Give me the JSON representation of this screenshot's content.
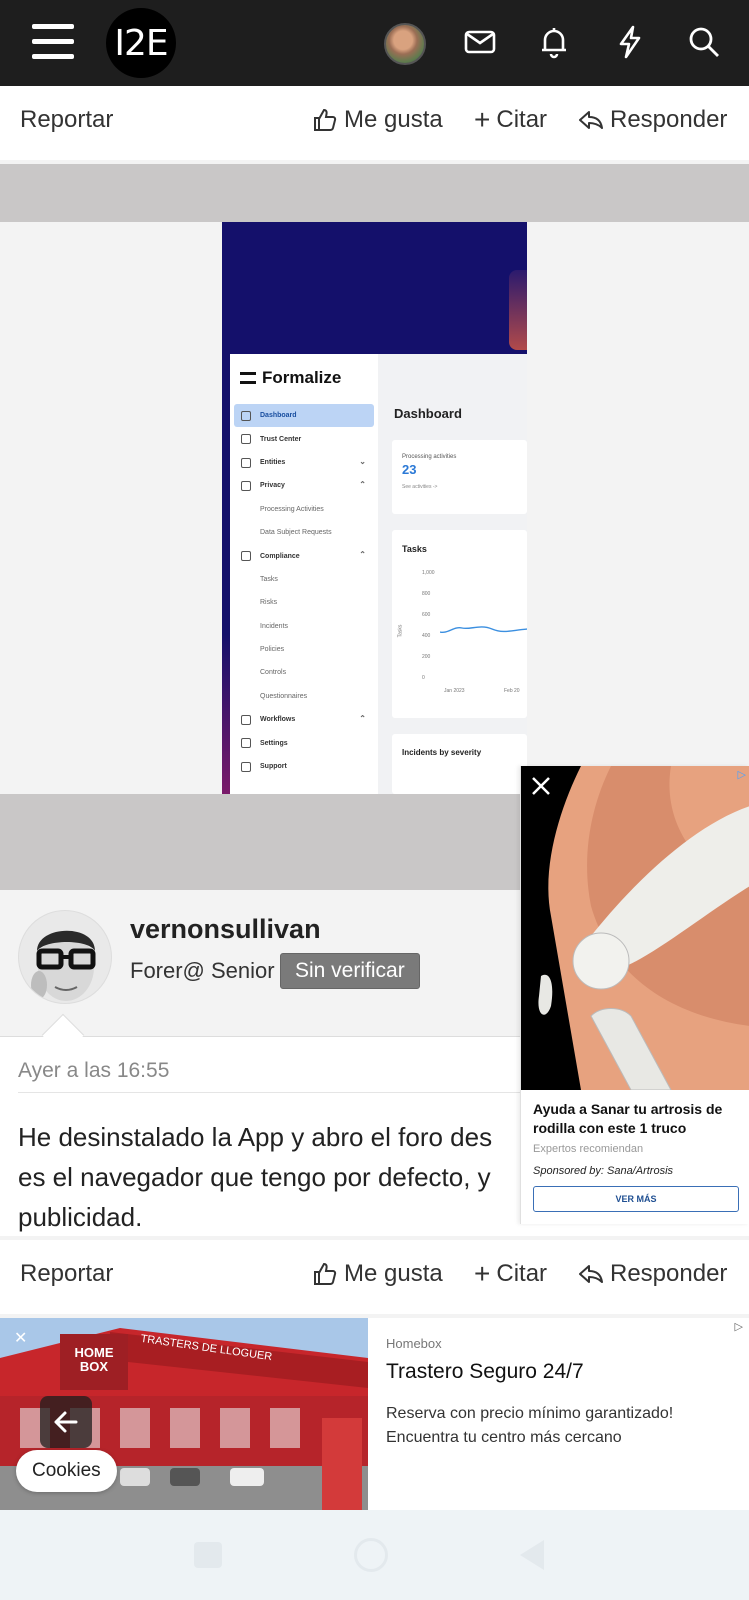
{
  "header": {
    "logo_text": "I2E",
    "icons": [
      "menu-icon",
      "avatar",
      "mail-icon",
      "bell-icon",
      "bolt-icon",
      "search-icon"
    ]
  },
  "actions": {
    "report": "Reportar",
    "like": "Me gusta",
    "quote": "Citar",
    "reply": "Responder"
  },
  "screenshot": {
    "app_name": "Formalize",
    "nav": [
      {
        "label": "Dashboard",
        "active": true
      },
      {
        "label": "Trust Center"
      },
      {
        "label": "Entities"
      },
      {
        "label": "Privacy"
      },
      {
        "label": "Processing Activities"
      },
      {
        "label": "Data Subject Requests"
      },
      {
        "label": "Compliance"
      },
      {
        "label": "Tasks"
      },
      {
        "label": "Risks"
      },
      {
        "label": "Incidents"
      },
      {
        "label": "Policies"
      },
      {
        "label": "Controls"
      },
      {
        "label": "Questionnaires"
      },
      {
        "label": "Workflows"
      },
      {
        "label": "Settings"
      },
      {
        "label": "Support"
      }
    ],
    "dashboard_title": "Dashboard",
    "processing_label": "Processing activities",
    "processing_value": "23",
    "processing_link": "See activities ->",
    "tasks_title": "Tasks",
    "tasks_axis": [
      "1,000",
      "800",
      "600",
      "400",
      "200",
      "0"
    ],
    "tasks_x": [
      "Jan 2023",
      "Feb 20"
    ],
    "tasks_ylabel": "Tasks",
    "incidents_title": "Incidents by severity"
  },
  "post": {
    "username": "vernonsullivan",
    "role": "Forer@ Senior",
    "badge": "Sin verificar",
    "date": "Ayer a las 16:55",
    "lines": [
      "He desinstalado la App y abro el foro des",
      "es el navegador que tengo por defecto, y",
      "publicidad."
    ]
  },
  "ad_knee": {
    "title": "Ayuda a Sanar tu artrosis de rodilla con este 1 truco",
    "subtitle": "Expertos recomiendan",
    "sponsor": "Sponsored by: Sana/Artrosis",
    "button": "VER MÁS"
  },
  "ad_bottom": {
    "source": "Homebox",
    "title": "Trastero Seguro 24/7",
    "description": "Reserva con precio mínimo garantizado! Encuentra tu centro más cercano",
    "sign_brand": "HOME BOX",
    "sign_text": "TRASTERS DE LLOGUER"
  },
  "cookies": "Cookies",
  "colors": {
    "header_bg": "#1e1e1e",
    "gray_band": "#c9c7c7",
    "badge_bg": "#7a7a7a",
    "ad_button": "#1f4f92"
  }
}
